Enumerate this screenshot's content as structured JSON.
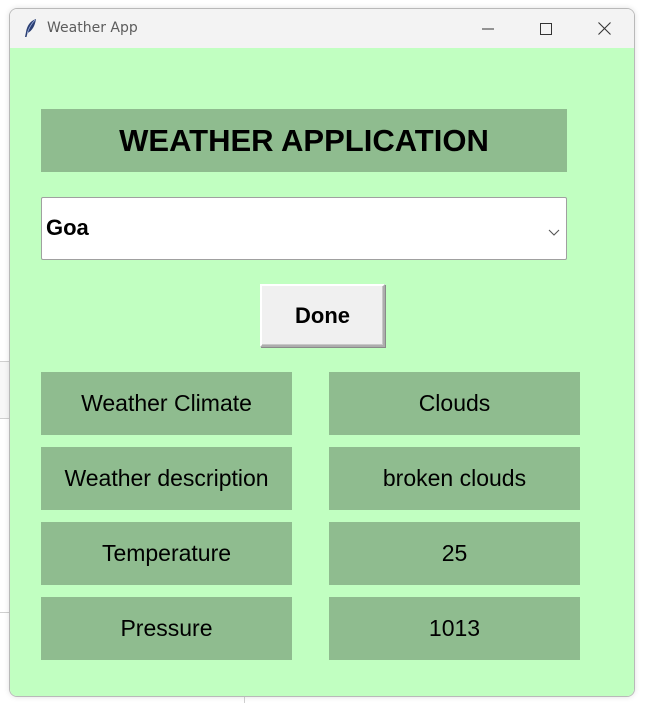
{
  "window": {
    "title": "Weather App",
    "icon": "feather-icon",
    "controls": {
      "minimize_icon": "minimize-icon",
      "maximize_icon": "maximize-icon",
      "close_icon": "close-icon"
    }
  },
  "app": {
    "heading": "WEATHER APPLICATION",
    "city_select": {
      "value": "Goa",
      "arrow_icon": "chevron-down-icon"
    },
    "done_label": "Done",
    "rows": [
      {
        "label": "Weather Climate",
        "value": "Clouds"
      },
      {
        "label": "Weather description",
        "value": "broken clouds"
      },
      {
        "label": "Temperature",
        "value": "25"
      },
      {
        "label": "Pressure",
        "value": "1013"
      }
    ]
  },
  "colors": {
    "background": "#c1ffc1",
    "panel": "#8fbc8f",
    "titlebar": "#f3f3f3",
    "button": "#f0f0f0"
  }
}
